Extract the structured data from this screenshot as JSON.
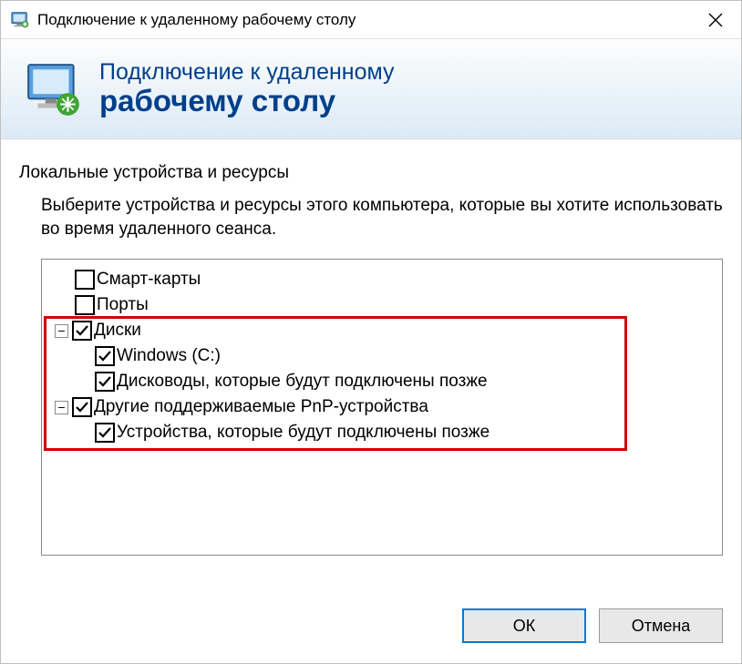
{
  "titlebar": {
    "title": "Подключение к удаленному рабочему столу"
  },
  "banner": {
    "line1": "Подключение к удаленному",
    "line2": "рабочему столу"
  },
  "section": {
    "title": "Локальные устройства и ресурсы",
    "description": "Выберите устройства и ресурсы этого компьютера, которые вы хотите использовать во время удаленного сеанса."
  },
  "tree": {
    "smartcards": {
      "label": "Смарт-карты",
      "checked": false
    },
    "ports": {
      "label": "Порты",
      "checked": false
    },
    "drives": {
      "label": "Диски",
      "checked": true,
      "expanded": true,
      "children": {
        "c": {
          "label": "Windows (C:)",
          "checked": true
        },
        "later": {
          "label": "Дисководы, которые будут подключены позже",
          "checked": true
        }
      }
    },
    "pnp": {
      "label": "Другие поддерживаемые PnP-устройства",
      "checked": true,
      "expanded": true,
      "children": {
        "later": {
          "label": "Устройства, которые будут подключены позже",
          "checked": true
        }
      }
    }
  },
  "buttons": {
    "ok": "ОК",
    "cancel": "Отмена"
  }
}
